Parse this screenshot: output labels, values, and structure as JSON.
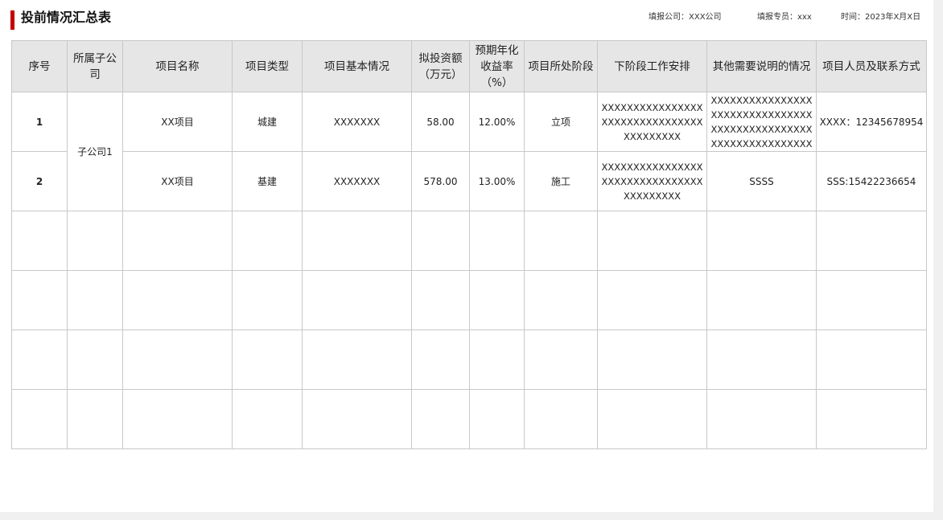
{
  "title": "投前情况汇总表",
  "meta": {
    "company": "填报公司：XXX公司",
    "person": "填报专员：xxx",
    "time": "时间：2023年X月X日"
  },
  "table": {
    "headers": [
      "序号",
      "所属子公司",
      "项目名称",
      "项目类型",
      "项目基本情况",
      "拟投资额（万元）",
      "预期年化收益率（%）",
      "项目所处阶段",
      "下阶段工作安排",
      "其他需要说明的情况",
      "项目人员及联系方式"
    ],
    "merged_subsidiary": "子公司1",
    "rows": [
      {
        "seq": "1",
        "name": "XX项目",
        "type": "城建",
        "basic": "XXXXXXX",
        "amount": "58.00",
        "rate": "12.00%",
        "stage": "立项",
        "next": "XXXXXXXXXXXXXXXXXXXXXXXXXXXXXXXXXXXXXXXXX",
        "other": "XXXXXXXXXXXXXXXXXXXXXXXXXXXXXXXXXXXXXXXXXXXXXXXXXXXXXXXXXXXXXXXX",
        "contact": "XXXX：12345678954"
      },
      {
        "seq": "2",
        "name": "XX项目",
        "type": "基建",
        "basic": "XXXXXXX",
        "amount": "578.00",
        "rate": "13.00%",
        "stage": "施工",
        "next": "XXXXXXXXXXXXXXXXXXXXXXXXXXXXXXXXXXXXXXXXX",
        "other": "SSSS",
        "contact": "SSS:15422236654"
      }
    ]
  }
}
